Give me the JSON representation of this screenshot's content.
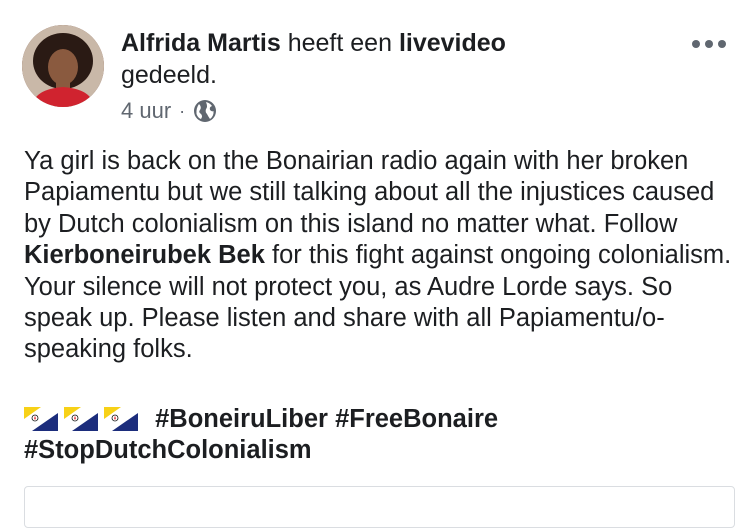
{
  "post": {
    "author": "Alfrida Martis",
    "action_pre": "heeft een",
    "action_object": "livevideo",
    "action_post": "gedeeld.",
    "time": "4 uur",
    "separator": "·",
    "privacy_icon": "globe-icon",
    "more_icon": "more-options-icon",
    "body_pre": "Ya girl is back on the Bonairian radio again with her broken Papiamentu but we still talking about all the injustices caused by Dutch colonialism on this island no matter what. Follow ",
    "body_mention": "Kierboneirubek Bek",
    "body_post": " for this fight against ongoing colonialism. Your silence will not protect you, as Audre Lorde says. So speak up. Please listen and share with all Papiamentu/o-speaking folks.",
    "flag_icon": "bonaire-flag-icon",
    "hashtags": [
      "#BoneiruLiber",
      "#FreeBonaire",
      "#StopDutchColonialism"
    ]
  },
  "colors": {
    "text": "#1c1e21",
    "meta": "#606770",
    "border": "#dadde1",
    "flag_blue": "#1c2d7c",
    "flag_yellow": "#f7d117",
    "flag_red": "#e01e2b"
  }
}
